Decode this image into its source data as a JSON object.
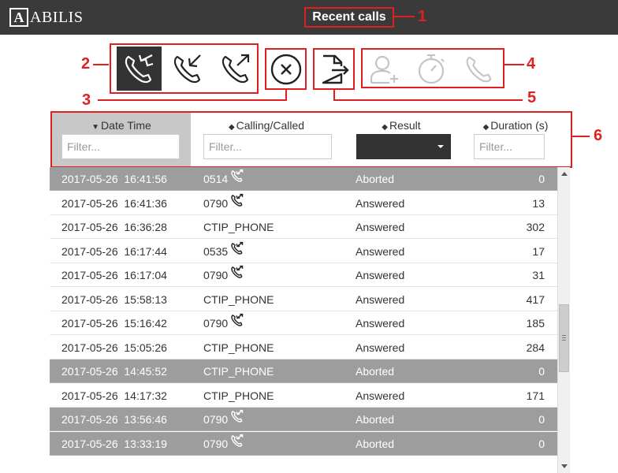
{
  "header": {
    "logo_letter": "A",
    "logo_text": "ABILIS",
    "title": "Recent calls"
  },
  "annotations": [
    "1",
    "2",
    "3",
    "4",
    "5",
    "6"
  ],
  "toolbar": {
    "filter_buttons": [
      {
        "icon": "phone-all-directions-icon",
        "active": true
      },
      {
        "icon": "phone-incoming-icon",
        "active": false
      },
      {
        "icon": "phone-outgoing-icon",
        "active": false
      }
    ],
    "clear_icon": "clear-x-icon",
    "export_icon": "export-file-icon",
    "disabled_actions": [
      "add-contact-icon",
      "stopwatch-icon",
      "phone-call-icon"
    ]
  },
  "table": {
    "columns": [
      {
        "label": "Date Time",
        "sort": "desc-active",
        "filter_placeholder": "Filter..."
      },
      {
        "label": "Calling/Called",
        "sort": "both",
        "filter_placeholder": "Filter..."
      },
      {
        "label": "Result",
        "sort": "both",
        "filter_type": "select",
        "selected": ""
      },
      {
        "label": "Duration (s)",
        "sort": "both",
        "filter_placeholder": "Filter..."
      }
    ],
    "rows": [
      {
        "date": "2017-05-26  16:41:56",
        "number": "0514",
        "icon": true,
        "result": "Aborted",
        "duration": "0",
        "aborted": true
      },
      {
        "date": "2017-05-26  16:41:36",
        "number": "0790",
        "icon": true,
        "result": "Answered",
        "duration": "13",
        "aborted": false
      },
      {
        "date": "2017-05-26  16:36:28",
        "number": "CTIP_PHONE",
        "icon": false,
        "result": "Answered",
        "duration": "302",
        "aborted": false
      },
      {
        "date": "2017-05-26  16:17:44",
        "number": "0535",
        "icon": true,
        "result": "Answered",
        "duration": "17",
        "aborted": false
      },
      {
        "date": "2017-05-26  16:17:04",
        "number": "0790",
        "icon": true,
        "result": "Answered",
        "duration": "31",
        "aborted": false
      },
      {
        "date": "2017-05-26  15:58:13",
        "number": "CTIP_PHONE",
        "icon": false,
        "result": "Answered",
        "duration": "417",
        "aborted": false
      },
      {
        "date": "2017-05-26  15:16:42",
        "number": "0790",
        "icon": true,
        "result": "Answered",
        "duration": "185",
        "aborted": false
      },
      {
        "date": "2017-05-26  15:05:26",
        "number": "CTIP_PHONE",
        "icon": false,
        "result": "Answered",
        "duration": "284",
        "aborted": false
      },
      {
        "date": "2017-05-26  14:45:52",
        "number": "CTIP_PHONE",
        "icon": false,
        "result": "Aborted",
        "duration": "0",
        "aborted": true
      },
      {
        "date": "2017-05-26  14:17:32",
        "number": "CTIP_PHONE",
        "icon": false,
        "result": "Answered",
        "duration": "171",
        "aborted": false
      },
      {
        "date": "2017-05-26  13:56:46",
        "number": "0790",
        "icon": true,
        "result": "Aborted",
        "duration": "0",
        "aborted": true
      },
      {
        "date": "2017-05-26  13:33:19",
        "number": "0790",
        "icon": true,
        "result": "Aborted",
        "duration": "0",
        "aborted": true
      }
    ]
  },
  "colors": {
    "accent_red": "#e02020",
    "header_bg": "#3a3a3a",
    "aborted_row": "#9d9d9d",
    "active_button": "#333333"
  }
}
